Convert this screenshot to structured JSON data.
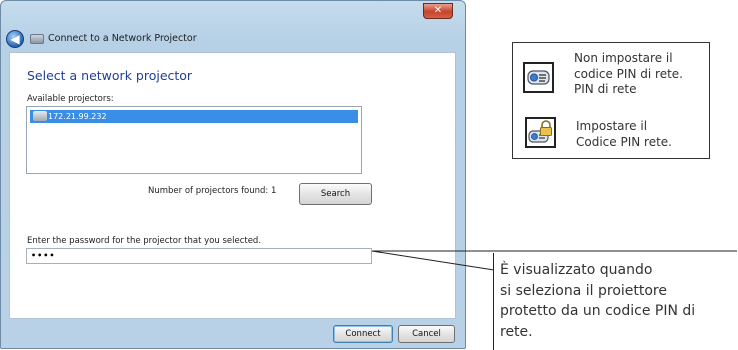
{
  "window": {
    "title": "Connect to a Network Projector",
    "close_glyph": "✕",
    "back_glyph": "◀"
  },
  "main": {
    "heading": "Select a network projector",
    "available_label": "Available projectors:",
    "projectors": [
      "172.21.99.232"
    ],
    "found_label": "Number of projectors found: 1",
    "search_label": "Search",
    "password_label": "Enter the password for the projector that you selected.",
    "password_value": "••••",
    "connect_label": "Connect",
    "cancel_label": "Cancel"
  },
  "legend": {
    "item1_lines": [
      "Non impostare il",
      "codice PIN di rete.",
      "PIN di rete"
    ],
    "item2_lines": [
      "Impostare il",
      "Codice PIN rete."
    ]
  },
  "annotation": {
    "lines": [
      "È visualizzato quando",
      "si seleziona il proiettore",
      "protetto da un codice PIN di",
      "rete."
    ]
  },
  "icons": {
    "back": "back-arrow-icon",
    "title": "network-projector-icon",
    "projector": "projector-icon",
    "legend1": "projector-no-pin-icon",
    "legend2": "projector-pin-lock-icon"
  },
  "colors": {
    "heading": "#1f3f99",
    "selection": "#3a8ee6",
    "close": "#c6442b"
  }
}
